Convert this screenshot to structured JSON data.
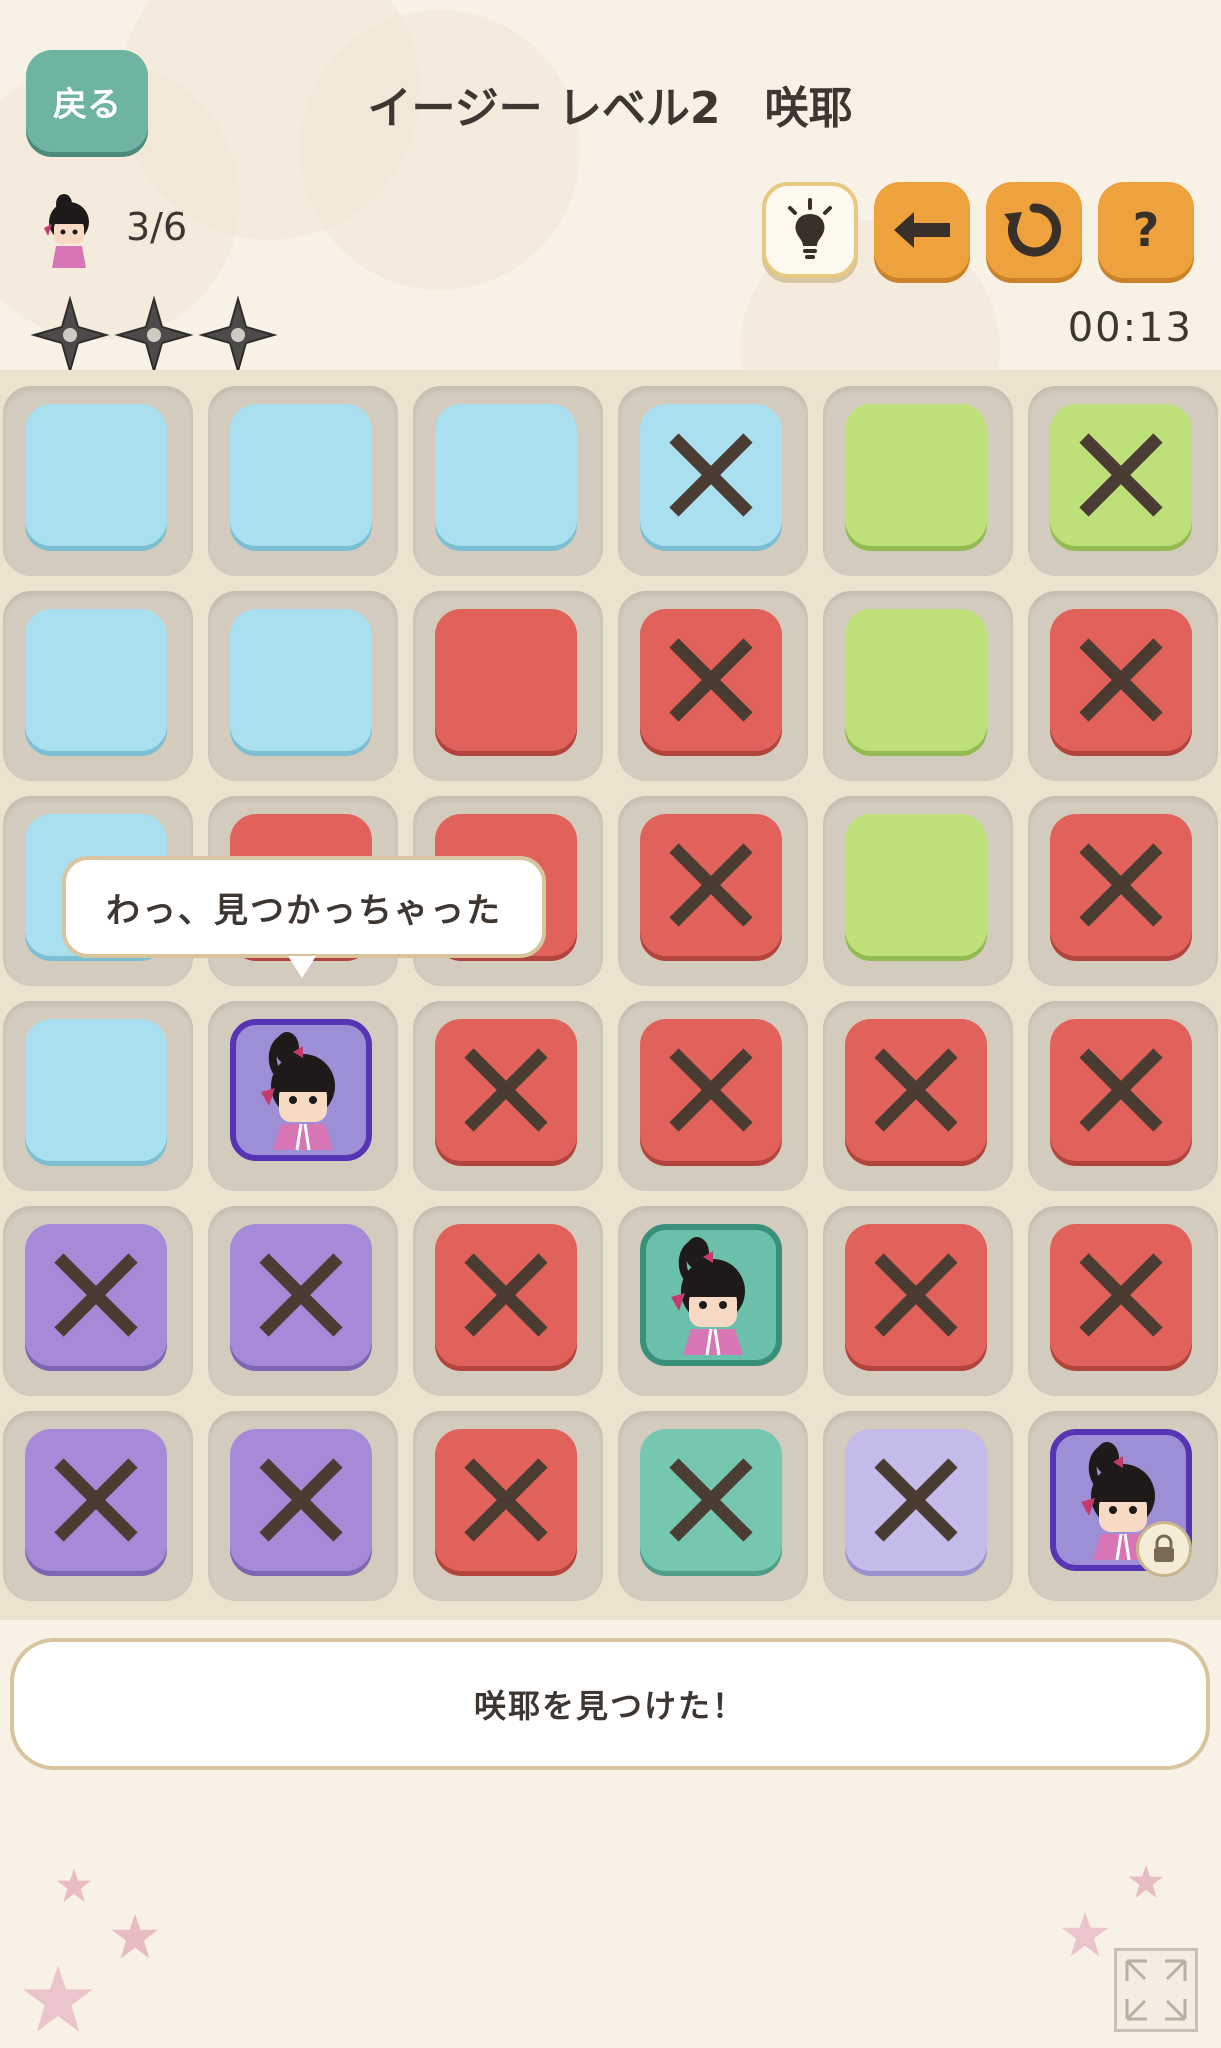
{
  "header": {
    "back_label": "戻る",
    "title": "イージー レベル2　咲耶",
    "progress": "3/6",
    "timer": "00:13"
  },
  "toolbar": {
    "items": [
      "hint-lightbulb-icon",
      "undo-arrow-icon",
      "reset-circular-arrow-icon",
      "help-question-icon"
    ],
    "help_label": "?"
  },
  "shuriken_count": 3,
  "speech": "わっ、見つかっちゃった",
  "message": "咲耶を見つけた！",
  "board": {
    "rows": 6,
    "cols": 6,
    "cells": [
      [
        {
          "color": "blue",
          "mark": ""
        },
        {
          "color": "blue",
          "mark": ""
        },
        {
          "color": "blue",
          "mark": ""
        },
        {
          "color": "blue",
          "mark": "x"
        },
        {
          "color": "green",
          "mark": ""
        },
        {
          "color": "green",
          "mark": "x"
        }
      ],
      [
        {
          "color": "blue",
          "mark": ""
        },
        {
          "color": "blue",
          "mark": ""
        },
        {
          "color": "red",
          "mark": ""
        },
        {
          "color": "red",
          "mark": "x"
        },
        {
          "color": "green",
          "mark": ""
        },
        {
          "color": "red",
          "mark": "x"
        }
      ],
      [
        {
          "color": "blue",
          "mark": ""
        },
        {
          "color": "red",
          "mark": ""
        },
        {
          "color": "red",
          "mark": ""
        },
        {
          "color": "red",
          "mark": "x"
        },
        {
          "color": "green",
          "mark": ""
        },
        {
          "color": "red",
          "mark": "x"
        }
      ],
      [
        {
          "color": "blue",
          "mark": ""
        },
        {
          "color": "char-purple",
          "mark": "ninja"
        },
        {
          "color": "red",
          "mark": "x"
        },
        {
          "color": "red",
          "mark": "x"
        },
        {
          "color": "red",
          "mark": "x"
        },
        {
          "color": "red",
          "mark": "x"
        }
      ],
      [
        {
          "color": "purple",
          "mark": "x"
        },
        {
          "color": "purple",
          "mark": "x"
        },
        {
          "color": "red",
          "mark": "x"
        },
        {
          "color": "char-teal",
          "mark": "ninja"
        },
        {
          "color": "red",
          "mark": "x"
        },
        {
          "color": "red",
          "mark": "x"
        }
      ],
      [
        {
          "color": "purple",
          "mark": "x"
        },
        {
          "color": "purple",
          "mark": "x"
        },
        {
          "color": "red",
          "mark": "x"
        },
        {
          "color": "teal",
          "mark": "x"
        },
        {
          "color": "lavender",
          "mark": "x"
        },
        {
          "color": "char-purple",
          "mark": "ninja-locked"
        }
      ]
    ]
  },
  "colors": {
    "accent_teal": "#6fb3a3",
    "accent_orange": "#eda23e",
    "mark_color": "#4a3c32"
  }
}
